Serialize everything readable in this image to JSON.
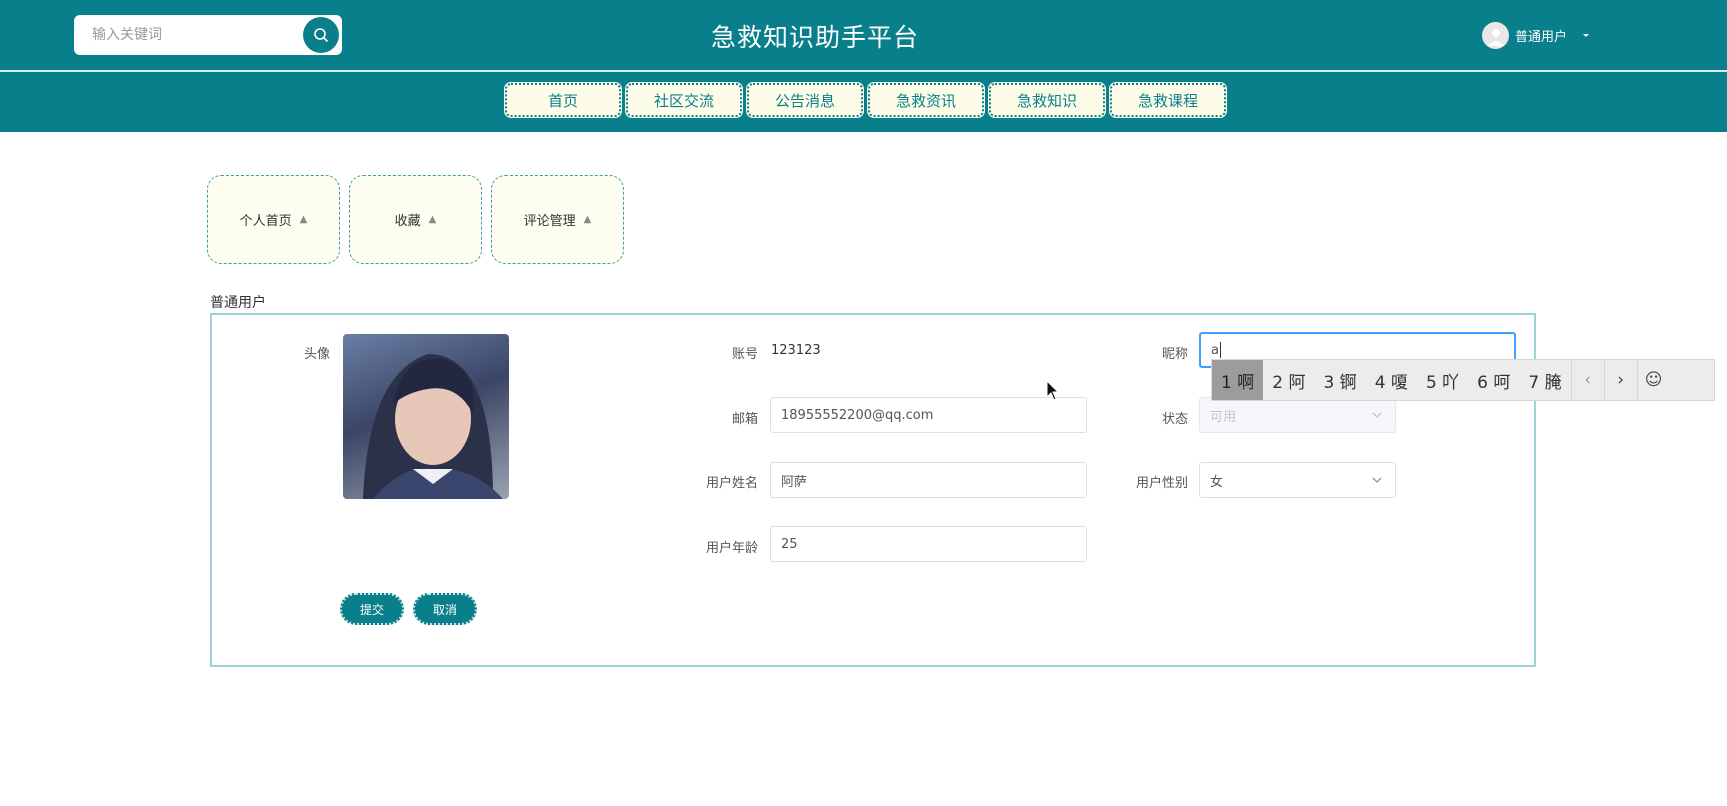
{
  "header": {
    "search_placeholder": "输入关键词",
    "site_title": "急救知识助手平台",
    "user_name": "普通用户"
  },
  "nav": {
    "items": [
      "首页",
      "社区交流",
      "公告消息",
      "急救资讯",
      "急救知识",
      "急救课程"
    ]
  },
  "tabs": {
    "items": [
      "个人首页",
      "收藏",
      "评论管理"
    ]
  },
  "profile": {
    "section_title": "普通用户",
    "avatar_label": "头像",
    "account_label": "账号",
    "account_value": "123123",
    "nickname_label": "昵称",
    "nickname_value": "a",
    "email_label": "邮箱",
    "email_value": "18955552200@qq.com",
    "status_label": "状态",
    "status_value": "可用",
    "realname_label": "用户姓名",
    "realname_value": "阿萨",
    "gender_label": "用户性别",
    "gender_value": "女",
    "age_label": "用户年龄",
    "age_value": "25",
    "submit_label": "提交",
    "cancel_label": "取消"
  },
  "ime": {
    "candidates": [
      "1 啊",
      "2 阿",
      "3 锕",
      "4 嗄",
      "5 吖",
      "6 呵",
      "7 腌"
    ]
  },
  "colors": {
    "brand": "#0a7f8c",
    "tab_bg": "#fdfdf0",
    "input_focus": "#409eff"
  }
}
